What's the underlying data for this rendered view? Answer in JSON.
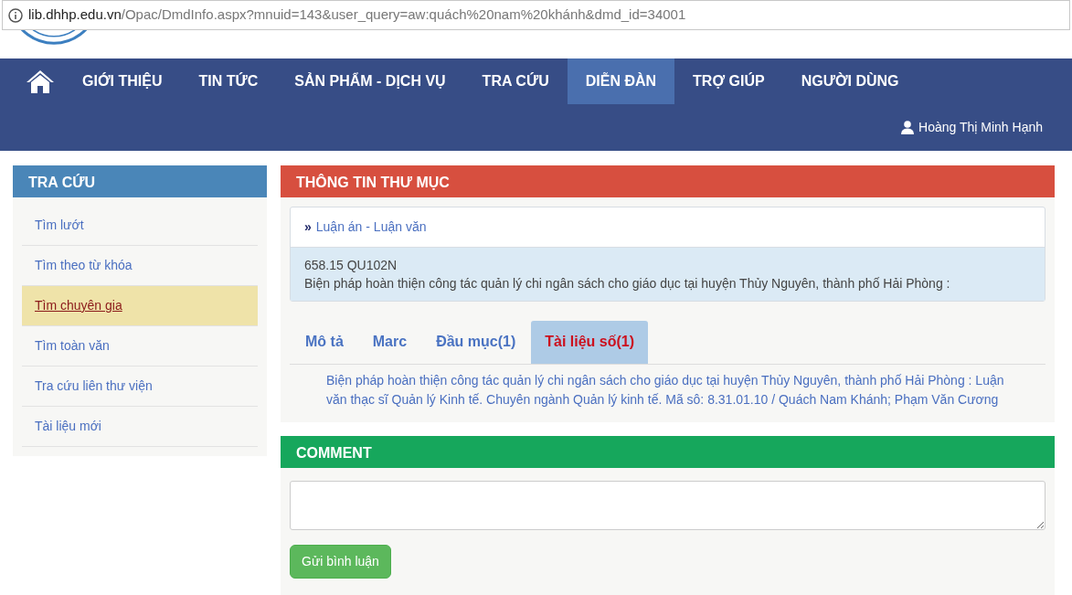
{
  "address_bar": {
    "host": "lib.dhhp.edu.vn",
    "path": "/Opac/DmdInfo.aspx?mnuid=143&user_query=aw:quách%20nam%20khánh&dmd_id=34001"
  },
  "nav": {
    "items": [
      {
        "label": "GIỚI THIỆU",
        "selected": false
      },
      {
        "label": "TIN TỨC",
        "selected": false
      },
      {
        "label": "SẢN PHẨM - DỊCH VỤ",
        "selected": false
      },
      {
        "label": "TRA CỨU",
        "selected": false
      },
      {
        "label": "DIỄN ĐÀN",
        "selected": true
      },
      {
        "label": "TRỢ GIÚP",
        "selected": false
      },
      {
        "label": "NGƯỜI DÙNG",
        "selected": false
      }
    ],
    "user": "Hoàng Thị Minh Hạnh"
  },
  "sidebar": {
    "title": "TRA CỨU",
    "items": [
      {
        "label": "Tìm lướt",
        "selected": false
      },
      {
        "label": "Tìm theo từ khóa",
        "selected": false
      },
      {
        "label": "Tìm chuyên gia",
        "selected": true
      },
      {
        "label": "Tìm toàn văn",
        "selected": false
      },
      {
        "label": "Tra cứu liên thư viện",
        "selected": false
      },
      {
        "label": "Tài liệu mới",
        "selected": false
      }
    ]
  },
  "record": {
    "title": "THÔNG TIN THƯ MỤC",
    "marker": "»",
    "category": "Luận án - Luận văn",
    "call_number": "658.15 QU102N",
    "summary": "Biện pháp hoàn thiện công tác quản lý chi ngân sách cho giáo dục tại huyện Thủy Nguyên, thành phố Hải Phòng :",
    "tabs": [
      {
        "label": "Mô tả",
        "selected": false
      },
      {
        "label": "Marc",
        "selected": false
      },
      {
        "label": "Đầu mục(1)",
        "selected": false
      },
      {
        "label": "Tài liệu số(1)",
        "selected": true
      }
    ],
    "tab_content": "Biện pháp hoàn thiện công tác quản lý chi ngân sách cho giáo dục tại huyện Thủy Nguyên, thành phố Hải Phòng : Luận văn thạc sĩ Quản lý Kinh tế. Chuyên ngành Quản lý kinh tế. Mã sô: 8.31.01.10 / Quách Nam Khánh; Phạm Văn Cương"
  },
  "comment": {
    "title": "COMMENT",
    "submit": "Gửi bình luận"
  }
}
